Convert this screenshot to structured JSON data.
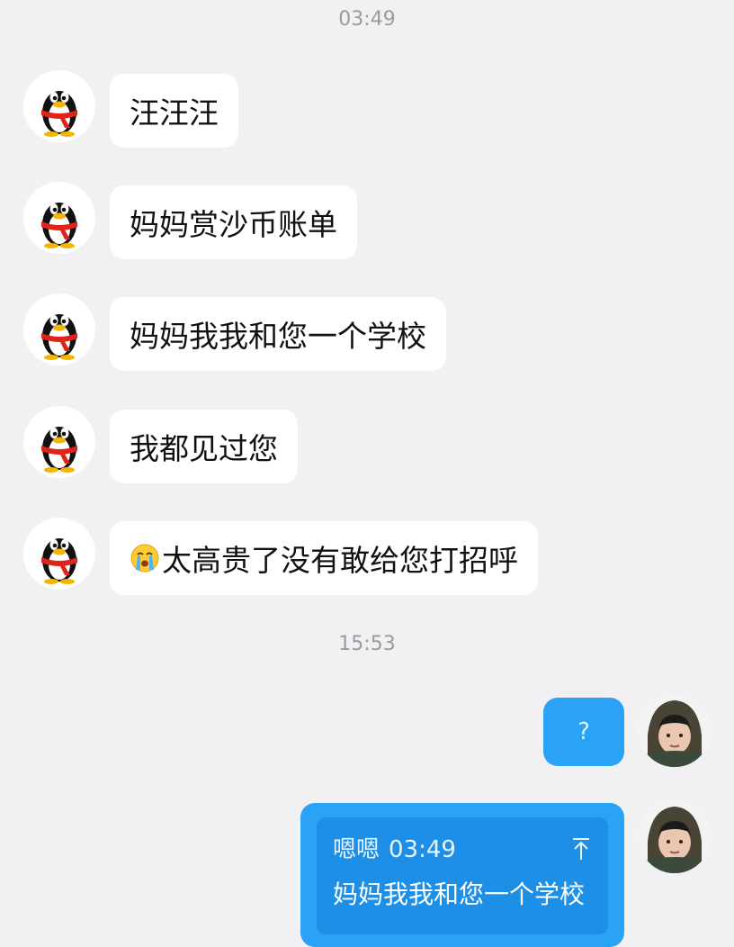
{
  "timestamps": [
    "03:49",
    "15:53"
  ],
  "incoming_messages": [
    {
      "text": "汪汪汪",
      "emoji": ""
    },
    {
      "text": "妈妈赏沙币账单",
      "emoji": ""
    },
    {
      "text": "妈妈我我和您一个学校",
      "emoji": ""
    },
    {
      "text": "我都见过您",
      "emoji": ""
    },
    {
      "text": "太高贵了没有敢给您打招呼",
      "emoji": "crying-emoji"
    }
  ],
  "outgoing_messages": [
    {
      "text": "?"
    },
    {
      "quote": {
        "sender": "嗯嗯",
        "time": "03:49",
        "text": "妈妈我我和您一个学校",
        "icon": "arrow-up-icon"
      }
    }
  ],
  "colors": {
    "background": "#f1f1f3",
    "incoming_bubble": "#ffffff",
    "outgoing_bubble": "#2aa3f6",
    "quote_box": "#1d8fe6",
    "timestamp": "#9b9b9f"
  },
  "avatars": {
    "incoming": "penguin-avatar-icon",
    "outgoing": "user-photo-avatar"
  }
}
